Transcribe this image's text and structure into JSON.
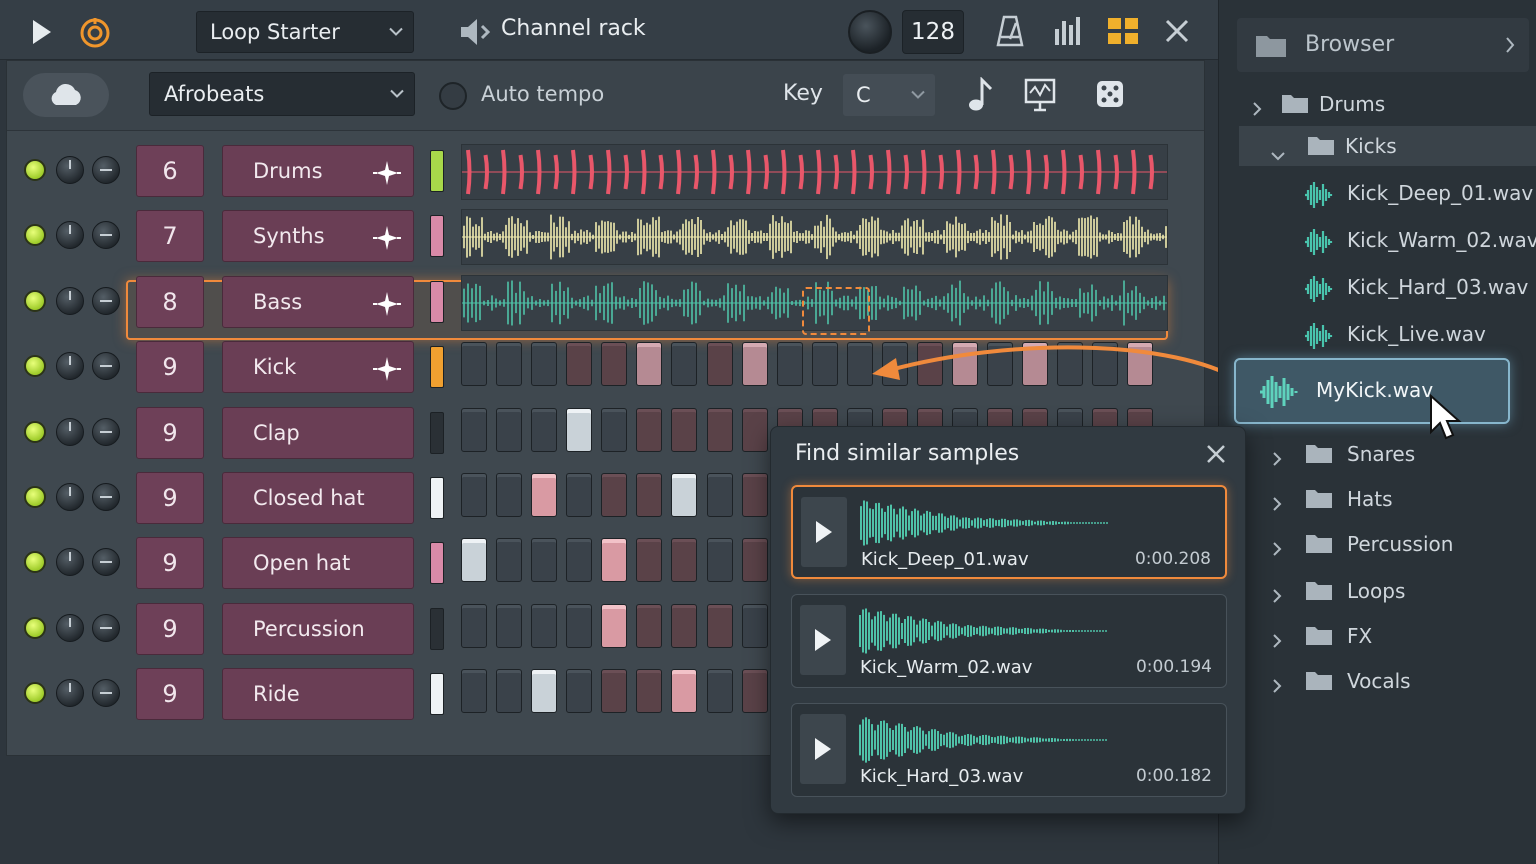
{
  "toolbar": {
    "pattern": "Loop Starter",
    "title": "Channel rack",
    "tempo": "128"
  },
  "secondbar": {
    "genre": "Afrobeats",
    "auto_tempo_label": "Auto tempo",
    "key_label": "Key",
    "key_value": "C"
  },
  "channels": [
    {
      "num": "6",
      "name": "Drums",
      "type": "wave",
      "meter": "#a8d84a",
      "wave_color": "#e8576a"
    },
    {
      "num": "7",
      "name": "Synths",
      "type": "wave",
      "meter": "#d98aa8",
      "wave_color": "#f2ecb0"
    },
    {
      "num": "8",
      "name": "Bass",
      "type": "wave",
      "meter": "#d98aa8",
      "wave_color": "#4fc2a8"
    },
    {
      "num": "9",
      "name": "Kick",
      "type": "steps",
      "meter": "#f0a030"
    },
    {
      "num": "9",
      "name": "Clap",
      "type": "steps",
      "meter": "#2a3035"
    },
    {
      "num": "9",
      "name": "Closed hat",
      "type": "steps",
      "meter": "#eef2f5"
    },
    {
      "num": "9",
      "name": "Open hat",
      "type": "steps",
      "meter": "#d98aa8"
    },
    {
      "num": "9",
      "name": "Percussion",
      "type": "steps",
      "meter": "#2a3035"
    },
    {
      "num": "9",
      "name": "Ride",
      "type": "steps",
      "meter": "#eef2f5"
    }
  ],
  "browser": {
    "title": "Browser",
    "folders_top": [
      "Drums",
      "Kicks"
    ],
    "kick_files": [
      "Kick_Deep_01.wav",
      "Kick_Warm_02.wav",
      "Kick_Hard_03.wav",
      "Kick_Live.wav"
    ],
    "dragged_file": "MyKick.wav",
    "folders_bottom": [
      "Snares",
      "Hats",
      "Percussion",
      "Loops",
      "FX",
      "Vocals"
    ]
  },
  "similar": {
    "title": "Find similar samples",
    "samples": [
      {
        "name": "Kick_Deep_01.wav",
        "duration": "0:00.208"
      },
      {
        "name": "Kick_Warm_02.wav",
        "duration": "0:00.194"
      },
      {
        "name": "Kick_Hard_03.wav",
        "duration": "0:00.182"
      }
    ]
  },
  "colors": {
    "accent": "#f08a3c",
    "channel": "#6a3e55",
    "waveform_teal": "#4fc2a8"
  }
}
